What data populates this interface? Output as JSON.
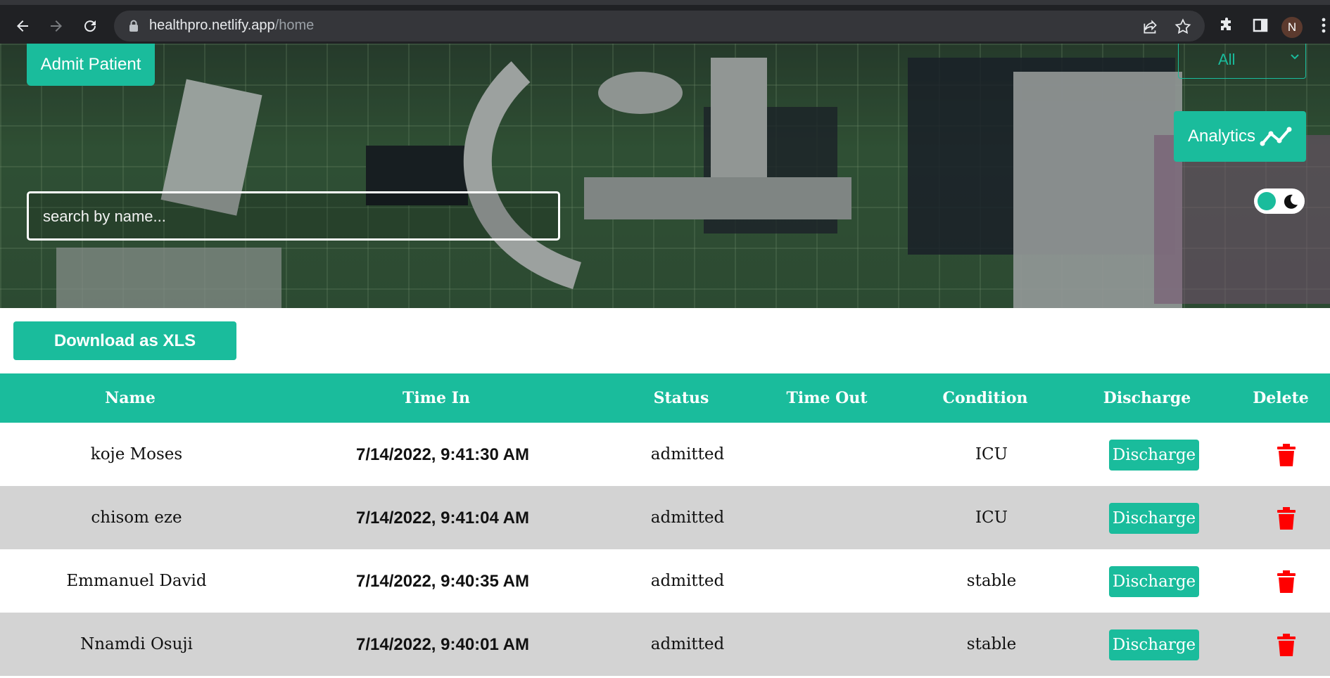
{
  "browser": {
    "url_host": "healthpro.netlify.app",
    "url_path": "/home",
    "avatar_initial": "N"
  },
  "header": {
    "admit_label": "Admit Patient",
    "filter_value": "All",
    "analytics_label": "Analytics",
    "search_placeholder": "search by name...",
    "theme_toggle_icon": "moon-icon"
  },
  "actions": {
    "download_label": "Download as XLS"
  },
  "table": {
    "columns": [
      "Name",
      "Time In",
      "Status",
      "Time Out",
      "Condition",
      "Discharge",
      "Delete"
    ],
    "rows": [
      {
        "name": "koje Moses",
        "time_in": "7/14/2022, 9:41:30 AM",
        "status": "admitted",
        "time_out": "",
        "condition": "ICU",
        "discharge_label": "Discharge"
      },
      {
        "name": "chisom eze",
        "time_in": "7/14/2022, 9:41:04 AM",
        "status": "admitted",
        "time_out": "",
        "condition": "ICU",
        "discharge_label": "Discharge"
      },
      {
        "name": "Emmanuel David",
        "time_in": "7/14/2022, 9:40:35 AM",
        "status": "admitted",
        "time_out": "",
        "condition": "stable",
        "discharge_label": "Discharge"
      },
      {
        "name": "Nnamdi Osuji",
        "time_in": "7/14/2022, 9:40:01 AM",
        "status": "admitted",
        "time_out": "",
        "condition": "stable",
        "discharge_label": "Discharge"
      }
    ]
  },
  "colors": {
    "accent": "#1abc9c",
    "delete": "#ff0000",
    "row_alt": "#d3d3d3"
  }
}
